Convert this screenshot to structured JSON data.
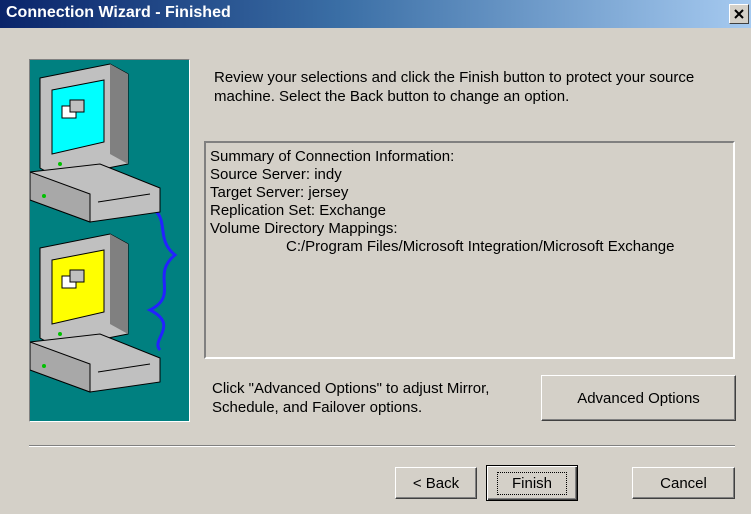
{
  "window": {
    "title": "Connection Wizard - Finished",
    "close_icon": "close-icon"
  },
  "colors": {
    "panel_background": "#008080",
    "dialog_background": "#d4d0c8",
    "titlebar_start": "#0a246a",
    "titlebar_end": "#a6caf0"
  },
  "illustration": {
    "icons": [
      "computer-icon",
      "network-cable-icon",
      "computer-icon"
    ],
    "screen_colors": [
      "#00ffff",
      "#ffff00"
    ]
  },
  "intro_text": "Review your selections and click the Finish button to protect your source machine. Select the Back button to change an option.",
  "summary": {
    "heading": "Summary of Connection Information:",
    "source_server": "Source Server: indy",
    "target_server": "Target Server: jersey",
    "replication_set": "Replication Set: Exchange",
    "volume_mappings_label": "Volume Directory Mappings:",
    "volume_mapping": "C:/Program Files/Microsoft Integration/Microsoft Exchange"
  },
  "advanced": {
    "hint": "Click \"Advanced Options\" to adjust Mirror, Schedule, and Failover options.",
    "button_label": "Advanced Options"
  },
  "buttons": {
    "back": "< Back",
    "finish": "Finish",
    "cancel": "Cancel"
  }
}
